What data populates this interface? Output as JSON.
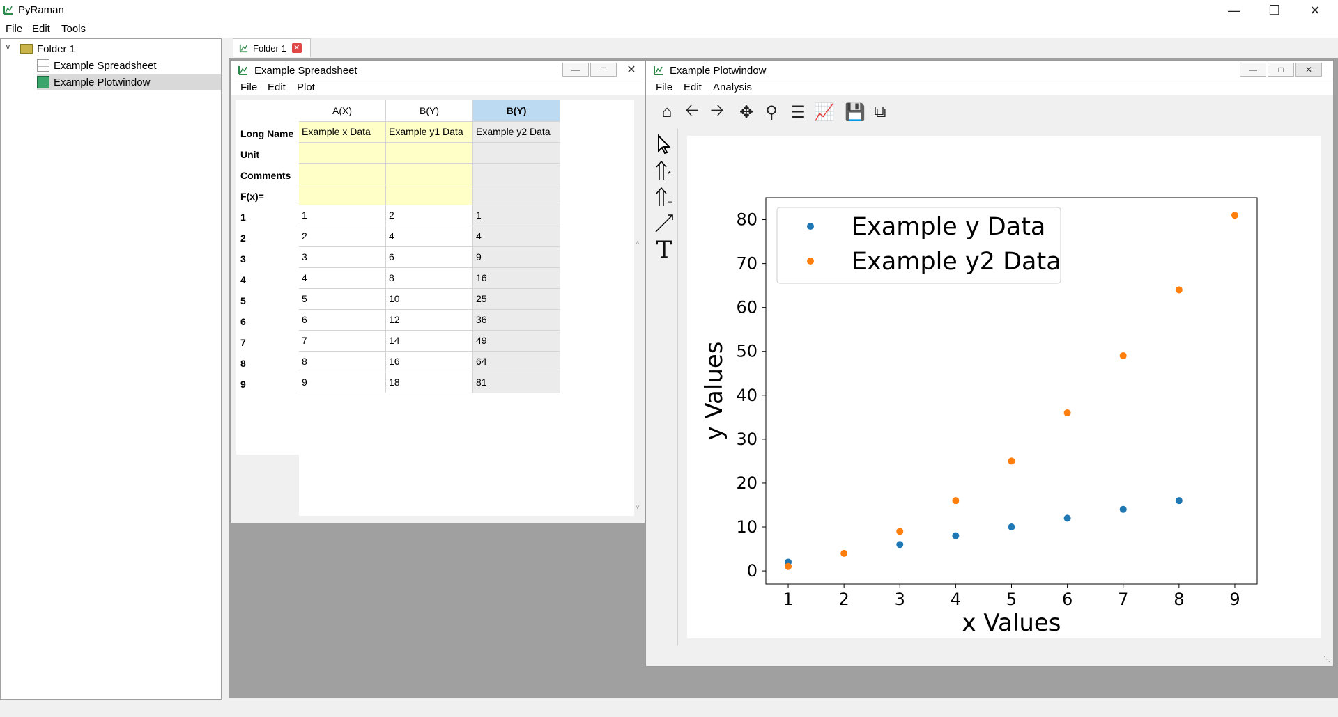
{
  "app": {
    "title": "PyRaman"
  },
  "menu": {
    "file": "File",
    "edit": "Edit",
    "tools": "Tools"
  },
  "tree": {
    "folder": "Folder 1",
    "items": [
      "Example Spreadsheet",
      "Example Plotwindow"
    ],
    "selected": "Example Plotwindow"
  },
  "mdi_tab": {
    "label": "Folder 1"
  },
  "spreadsheet": {
    "title": "Example Spreadsheet",
    "menu": [
      "File",
      "Edit",
      "Plot"
    ],
    "row_headers_meta": [
      "Long Name",
      "Unit",
      "Comments",
      "F(x)="
    ],
    "columns": [
      {
        "header": "A(X)",
        "long_name": "Example x Data",
        "values": [
          "1",
          "2",
          "3",
          "4",
          "5",
          "6",
          "7",
          "8",
          "9"
        ]
      },
      {
        "header": "B(Y)",
        "long_name": "Example y1 Data",
        "values": [
          "2",
          "4",
          "6",
          "8",
          "10",
          "12",
          "14",
          "16",
          "18"
        ]
      },
      {
        "header": "B(Y)",
        "long_name": "Example y2 Data",
        "values": [
          "1",
          "4",
          "9",
          "16",
          "25",
          "36",
          "49",
          "64",
          "81"
        ]
      }
    ],
    "row_numbers": [
      "1",
      "2",
      "3",
      "4",
      "5",
      "6",
      "7",
      "8",
      "9"
    ]
  },
  "plotwindow": {
    "title": "Example Plotwindow",
    "menu": [
      "File",
      "Edit",
      "Analysis"
    ],
    "toolbar": [
      "home-icon",
      "back-icon",
      "forward-icon",
      "pan-icon",
      "zoom-icon",
      "configure-subplots-icon",
      "edit-curve-icon",
      "save-icon",
      "copy-icon"
    ],
    "side_tools": [
      "select-arrow-icon",
      "insert-arrow-star-icon",
      "insert-arrow-plus-icon",
      "line-tool-icon",
      "text-tool-icon"
    ]
  },
  "chart_data": {
    "type": "scatter",
    "xlabel": "x Values",
    "ylabel": "y Values",
    "xlim": [
      0.6,
      9.4
    ],
    "ylim": [
      -3,
      85
    ],
    "xticks": [
      "1",
      "2",
      "3",
      "4",
      "5",
      "6",
      "7",
      "8",
      "9"
    ],
    "yticks": [
      "0",
      "10",
      "20",
      "30",
      "40",
      "50",
      "60",
      "70",
      "80"
    ],
    "legend_position": "top-left",
    "series": [
      {
        "name": "Example y Data",
        "color": "#1f77b4",
        "x": [
          1,
          3,
          4,
          5,
          6,
          7,
          8
        ],
        "y": [
          2,
          6,
          8,
          10,
          12,
          14,
          16
        ]
      },
      {
        "name": "Example y2 Data",
        "color": "#ff7f0e",
        "x": [
          1,
          2,
          3,
          4,
          5,
          6,
          7,
          8,
          9
        ],
        "y": [
          1,
          4,
          9,
          16,
          25,
          36,
          49,
          64,
          81
        ]
      }
    ]
  }
}
